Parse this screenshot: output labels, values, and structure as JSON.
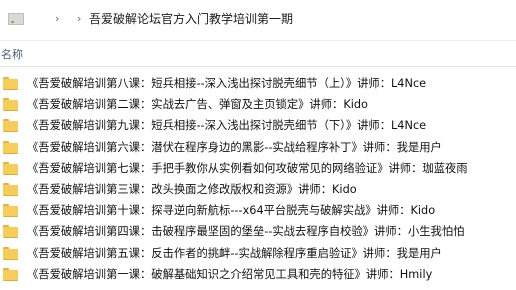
{
  "address_bar": {
    "separator": "›",
    "current_folder": "吾爱破解论坛官方入门教学培训第一期"
  },
  "columns": {
    "name_label": "名称"
  },
  "files": [
    {
      "name": "《吾爱破解培训第八课：短兵相接--深入浅出探讨脱壳细节（上）》讲师：L4Nce"
    },
    {
      "name": "《吾爱破解培训第二课：实战去广告、弹窗及主页锁定》讲师：Kido"
    },
    {
      "name": "《吾爱破解培训第九课：短兵相接--深入浅出探讨脱壳细节（下）》讲师：L4Nce"
    },
    {
      "name": "《吾爱破解培训第六课：潜伏在程序身边的黑影--实战给程序补丁》讲师：我是用户"
    },
    {
      "name": "《吾爱破解培训第七课：手把手教你从实例看如何攻破常见的网络验证》讲师：珈蓝夜雨"
    },
    {
      "name": "《吾爱破解培训第三课：改头换面之修改版权和资源》讲师：Kido"
    },
    {
      "name": "《吾爱破解培训第十课：探寻逆向新航标---x64平台脱壳与破解实战》讲师：Kido"
    },
    {
      "name": "《吾爱破解培训第四课：击破程序最坚固的堡垒--实战去程序自校验》讲师：小生我怕怕"
    },
    {
      "name": "《吾爱破解培训第五课：反击作者的挑衅--实战解除程序重启验证》讲师：我是用户"
    },
    {
      "name": "《吾爱破解培训第一课：破解基础知识之介绍常见工具和壳的特征》讲师：Hmily"
    }
  ]
}
